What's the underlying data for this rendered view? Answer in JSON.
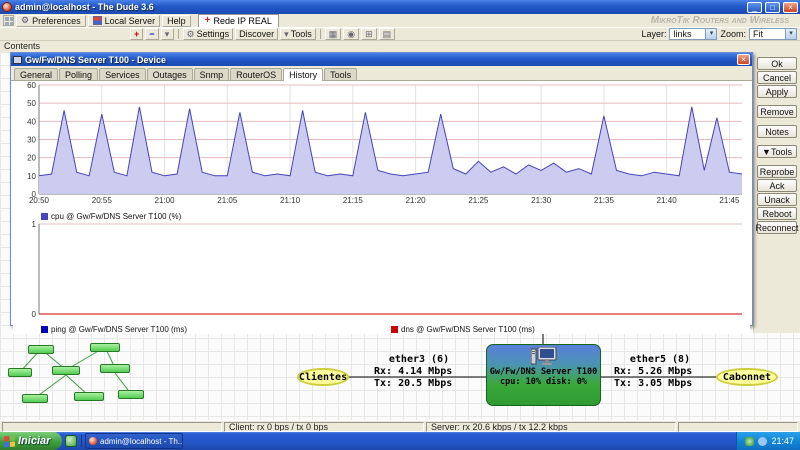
{
  "window_title": "admin@localhost - The Dude 3.6",
  "watermark": "MikroTik Routers and Wireless",
  "icons": {
    "gear": "⚙",
    "chevron_down": "▾",
    "grid": "▦",
    "target": "◉",
    "window_glyph": "⊞",
    "rows": "▤",
    "plus": "+",
    "minus": "−",
    "map_cross": "+",
    "close": "×",
    "minimize": "_",
    "maximize": "□"
  },
  "menubar": {
    "preferences": "Preferences",
    "local_server": "Local Server",
    "help": "Help"
  },
  "map_tab": "Rede IP REAL",
  "toolbar": {
    "settings": "Settings",
    "discover": "Discover",
    "tools": "Tools",
    "layer_label": "Layer:",
    "layer_value": "links",
    "zoom_label": "Zoom:",
    "zoom_value": "Fit"
  },
  "contents_header": "Contents",
  "dialog": {
    "title": "Gw/Fw/DNS Server T100 - Device",
    "tabs": [
      "General",
      "Polling",
      "Services",
      "Outages",
      "Snmp",
      "RouterOS",
      "History",
      "Tools"
    ],
    "active_tab": "History",
    "buttons": [
      "Ok",
      "Cancel",
      "Apply",
      "Remove",
      "Notes",
      "▼Tools",
      "Reprobe",
      "Ack",
      "Unack",
      "Reboot",
      "Reconnect"
    ]
  },
  "chart_data": [
    {
      "type": "area",
      "x_tick_labels": [
        "20:50",
        "20:55",
        "21:00",
        "21:05",
        "21:10",
        "21:15",
        "21:20",
        "21:25",
        "21:30",
        "21:35",
        "21:40",
        "21:45"
      ],
      "x_minutes_span": 56,
      "ylim": [
        0,
        60
      ],
      "y_ticks": [
        0,
        10,
        20,
        30,
        40,
        50,
        60
      ],
      "grid": true,
      "series": [
        {
          "name": "cpu @ Gw/Fw/DNS Server T100 (%)",
          "color": "#4444bb",
          "fill": "#ccccf0",
          "values": [
            10,
            11,
            46,
            12,
            10,
            44,
            12,
            10,
            48,
            12,
            10,
            11,
            47,
            12,
            10,
            10,
            45,
            12,
            10,
            11,
            10,
            46,
            12,
            10,
            11,
            10,
            45,
            13,
            11,
            10,
            11,
            12,
            44,
            14,
            11,
            18,
            12,
            15,
            11,
            16,
            13,
            17,
            12,
            14,
            11,
            43,
            13,
            11,
            10,
            12,
            11,
            10,
            48,
            13,
            42,
            12,
            11
          ]
        }
      ]
    },
    {
      "type": "line",
      "x_tick_labels": [],
      "ylim": [
        0,
        1
      ],
      "y_ticks": [
        0,
        1
      ],
      "grid": true,
      "series": [
        {
          "name": "ping @ Gw/Fw/DNS Server T100 (ms)",
          "color": "#0000bb",
          "values": [
            0,
            0
          ]
        },
        {
          "name": "dns @ Gw/Fw/DNS Server T100 (ms)",
          "color": "#cc0000",
          "values": [
            0,
            0
          ]
        }
      ]
    }
  ],
  "map": {
    "clientes_label": "Clientes",
    "cabonnet_label": "Cabonnet",
    "link_left": {
      "name": "ether3 (6)",
      "rx": "Rx: 4.14 Mbps",
      "tx": "Tx: 20.5 Mbps"
    },
    "link_right": {
      "name": "ether5 (8)",
      "rx": "Rx: 5.26 Mbps",
      "tx": "Tx: 3.05 Mbps"
    },
    "server": {
      "name": "Gw/Fw/DNS Server T100",
      "status": "cpu: 10% disk: 0%"
    }
  },
  "statusbar": {
    "client": "Client: rx 0 bps / tx 0 bps",
    "server": "Server: rx 20.6 kbps / tx 12.2 kbps"
  },
  "taskbar": {
    "start_label": "Iniciar",
    "task_label": "admin@localhost - Th...",
    "clock": "21:47"
  }
}
